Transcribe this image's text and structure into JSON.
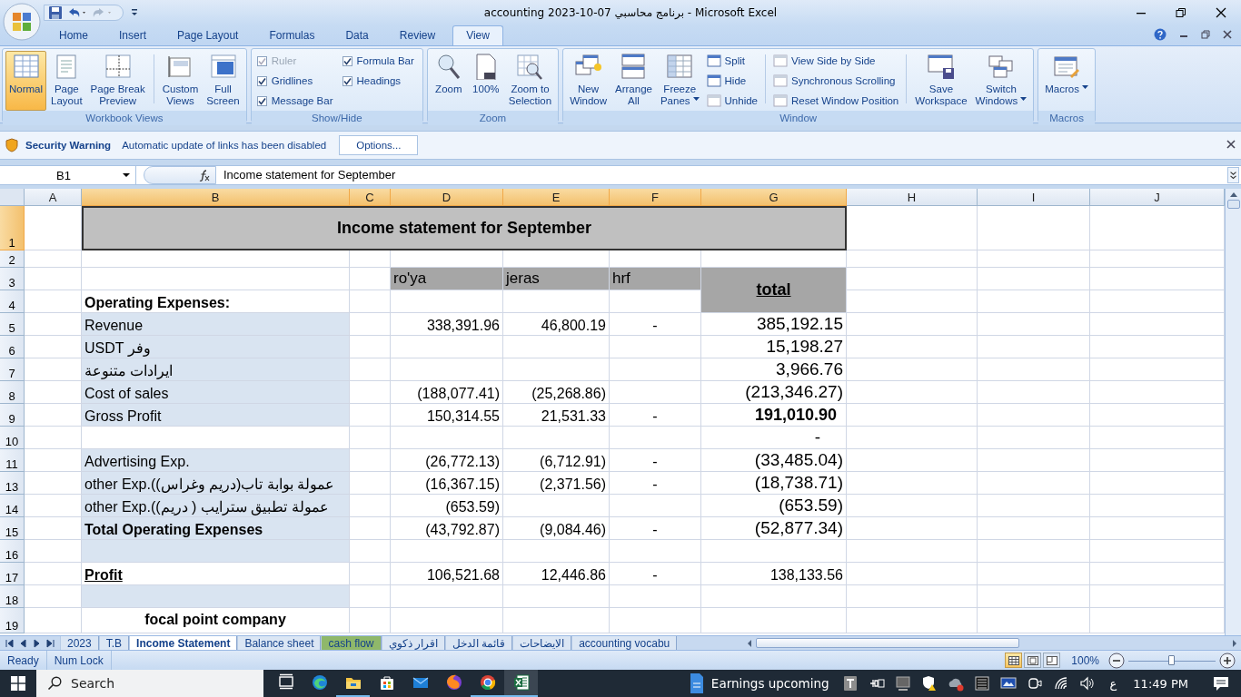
{
  "window": {
    "title": "accounting 2023-10-07 برنامج محاسبي - Microsoft Excel"
  },
  "ribbon": {
    "tabs": [
      {
        "label": "Home",
        "selected": false
      },
      {
        "label": "Insert",
        "selected": false
      },
      {
        "label": "Page Layout",
        "selected": false
      },
      {
        "label": "Formulas",
        "selected": false
      },
      {
        "label": "Data",
        "selected": false
      },
      {
        "label": "Review",
        "selected": false
      },
      {
        "label": "View",
        "selected": true
      }
    ],
    "groups": [
      {
        "title": "Workbook Views",
        "items": [
          {
            "kind": "large",
            "label": "Normal",
            "selected": true,
            "dropdown": false
          },
          {
            "kind": "large",
            "label": "Page Layout",
            "selected": false,
            "dropdown": false
          },
          {
            "kind": "large",
            "label": "Page Break Preview",
            "selected": false,
            "dropdown": false
          },
          {
            "kind": "separator"
          },
          {
            "kind": "large",
            "label": "Custom Views",
            "selected": false,
            "dropdown": false
          },
          {
            "kind": "large",
            "label": "Full Screen",
            "selected": false,
            "dropdown": false
          }
        ]
      },
      {
        "title": "Show/Hide",
        "items": [
          {
            "kind": "check",
            "label": "Ruler",
            "checked": true,
            "disabled": true
          },
          {
            "kind": "check",
            "label": "Gridlines",
            "checked": true,
            "disabled": false
          },
          {
            "kind": "check",
            "label": "Message Bar",
            "checked": true,
            "disabled": false
          },
          {
            "kind": "check",
            "label": "Formula Bar",
            "checked": true,
            "disabled": false
          },
          {
            "kind": "check",
            "label": "Headings",
            "checked": true,
            "disabled": false
          }
        ]
      },
      {
        "title": "Zoom",
        "items": [
          {
            "kind": "large",
            "label": "Zoom",
            "selected": false,
            "dropdown": false
          },
          {
            "kind": "large",
            "label": "100%",
            "selected": false,
            "dropdown": false
          },
          {
            "kind": "large",
            "label": "Zoom to Selection",
            "selected": false,
            "dropdown": false
          }
        ]
      },
      {
        "title": "Window",
        "items": [
          {
            "kind": "large",
            "label": "New Window",
            "selected": false,
            "dropdown": false
          },
          {
            "kind": "large",
            "label": "Arrange All",
            "selected": false,
            "dropdown": false
          },
          {
            "kind": "large",
            "label": "Freeze Panes",
            "selected": false,
            "dropdown": true
          },
          {
            "kind": "small",
            "label": "Split",
            "disabled": false
          },
          {
            "kind": "small",
            "label": "Hide",
            "disabled": false
          },
          {
            "kind": "small",
            "label": "Unhide",
            "disabled": true
          },
          {
            "kind": "separator"
          },
          {
            "kind": "small",
            "label": "View Side by Side",
            "disabled": true
          },
          {
            "kind": "small",
            "label": "Synchronous Scrolling",
            "disabled": true
          },
          {
            "kind": "small",
            "label": "Reset Window Position",
            "disabled": true
          },
          {
            "kind": "separator"
          },
          {
            "kind": "large",
            "label": "Save Workspace",
            "selected": false,
            "dropdown": false
          },
          {
            "kind": "large",
            "label": "Switch Windows",
            "selected": false,
            "dropdown": true
          }
        ]
      },
      {
        "title": "Macros",
        "items": [
          {
            "kind": "large",
            "label": "Macros",
            "selected": false,
            "dropdown": true
          }
        ]
      }
    ]
  },
  "message_bar": {
    "title": "Security Warning",
    "text": "Automatic update of links has been disabled",
    "button": "Options..."
  },
  "formula_bar": {
    "name_box": "B1",
    "formula": "Income statement for September"
  },
  "sheet": {
    "columns": [
      {
        "label": "A",
        "selected": false
      },
      {
        "label": "B",
        "selected": true
      },
      {
        "label": "C",
        "selected": true
      },
      {
        "label": "D",
        "selected": true
      },
      {
        "label": "E",
        "selected": true
      },
      {
        "label": "F",
        "selected": true
      },
      {
        "label": "G",
        "selected": true
      },
      {
        "label": "H",
        "selected": false
      },
      {
        "label": "I",
        "selected": false
      },
      {
        "label": "J",
        "selected": false
      }
    ],
    "rows": [
      {
        "number": "1",
        "selected": true,
        "title": "Income statement for September"
      },
      {
        "number": "2",
        "selected": false,
        "shaded": false
      },
      {
        "number": "3",
        "selected": false,
        "shaded": false,
        "d": {
          "text": "ro'ya",
          "kind": "label"
        },
        "e": {
          "text": "jeras",
          "kind": "label"
        },
        "f": {
          "text": "hrf",
          "kind": "label"
        },
        "g": {
          "text": "total",
          "kind": "heading"
        }
      },
      {
        "number": "4",
        "selected": false,
        "shaded": false,
        "b": {
          "text": "Operating Expenses:",
          "kind": "bold"
        }
      },
      {
        "number": "5",
        "selected": false,
        "shaded": true,
        "b": "Revenue",
        "d": "338,391.96",
        "e": "46,800.19",
        "f": "-",
        "g": {
          "text": "385,192.15",
          "kind": "large"
        }
      },
      {
        "number": "6",
        "selected": false,
        "shaded": true,
        "b": "USDT وفر",
        "g": {
          "text": "15,198.27",
          "kind": "large"
        }
      },
      {
        "number": "7",
        "selected": false,
        "shaded": true,
        "b": " ايرادات متنوعة",
        "g": {
          "text": "3,966.76",
          "kind": "large"
        }
      },
      {
        "number": "8",
        "selected": false,
        "shaded": true,
        "b": "Cost of sales",
        "d": "(188,077.41)",
        "e": "(25,268.86)",
        "g": {
          "text": "(213,346.27)",
          "kind": "large"
        }
      },
      {
        "number": "9",
        "selected": false,
        "shaded": true,
        "b": "Gross Profit",
        "d": "150,314.55",
        "e": "21,531.33",
        "f": "-",
        "g": {
          "text": "191,010.90",
          "kind": "emphasis"
        }
      },
      {
        "number": "10",
        "selected": false,
        "shaded": false,
        "g": {
          "text": "-",
          "kind": "dash"
        }
      },
      {
        "number": "11",
        "selected": false,
        "shaded": true,
        "b": "Advertising Exp.",
        "d": "(26,772.13)",
        "e": "(6,712.91)",
        "f": "-",
        "g": {
          "text": "(33,485.04)",
          "kind": "large"
        }
      },
      {
        "number": "13",
        "selected": false,
        "shaded": true,
        "b": "other Exp.(عمولة بوابة  تاب(دريم وغراس)",
        "d": "(16,367.15)",
        "e": "(2,371.56)",
        "f": "-",
        "g": {
          "text": "(18,738.71)",
          "kind": "large"
        }
      },
      {
        "number": "14",
        "selected": false,
        "shaded": true,
        "b": "other Exp.(عمولة تطبيق سترايب ( دريم)",
        "d": "(653.59)",
        "g": {
          "text": "(653.59)",
          "kind": "large"
        }
      },
      {
        "number": "15",
        "selected": false,
        "shaded": true,
        "b": {
          "text": "Total Operating Expenses",
          "kind": "bold"
        },
        "d": "(43,792.87)",
        "e": "(9,084.46)",
        "f": "-",
        "g": {
          "text": "(52,877.34)",
          "kind": "large"
        }
      },
      {
        "number": "16",
        "selected": false,
        "shaded": true
      },
      {
        "number": "17",
        "selected": false,
        "shaded": false,
        "b": {
          "text": " Profit",
          "kind": "underline"
        },
        "d": "106,521.68",
        "e": "12,446.86",
        "f": "-",
        "g": "138,133.56"
      },
      {
        "number": "18",
        "selected": false,
        "shaded": true
      },
      {
        "number": "19",
        "selected": false,
        "shaded": false,
        "b": {
          "text": "focal point company",
          "kind": "caption"
        }
      }
    ]
  },
  "sheet_tabs": [
    {
      "label": "2023",
      "selected": false
    },
    {
      "label": "T.B",
      "selected": false
    },
    {
      "label": "Income Statement",
      "selected": true
    },
    {
      "label": "Balance sheet",
      "selected": false
    },
    {
      "label": "cash flow",
      "selected": false,
      "color": "#8fb86a"
    },
    {
      "label": "اقرار ذكوي",
      "selected": false
    },
    {
      "label": "قائمة الدخل",
      "selected": false
    },
    {
      "label": "الايضاحات",
      "selected": false
    },
    {
      "label": "accounting vocabu",
      "selected": false
    }
  ],
  "status_bar": {
    "items": [
      "Ready",
      "Num Lock"
    ],
    "views": [
      {
        "selected": true
      },
      {
        "selected": false
      },
      {
        "selected": false
      }
    ],
    "zoom": "100%",
    "zoom_slider": {
      "level": 0.5
    }
  },
  "taskbar": {
    "search": "Search",
    "apps": [
      {
        "selected": false,
        "running": false
      },
      {
        "selected": false,
        "running": false
      },
      {
        "selected": false,
        "running": true
      },
      {
        "selected": false,
        "running": false
      },
      {
        "selected": false,
        "running": false
      },
      {
        "selected": false,
        "running": false
      },
      {
        "selected": false,
        "running": true
      },
      {
        "selected": true,
        "running": true
      }
    ],
    "weather": "Earnings upcoming",
    "language": "ع",
    "time": "11:49 PM"
  }
}
